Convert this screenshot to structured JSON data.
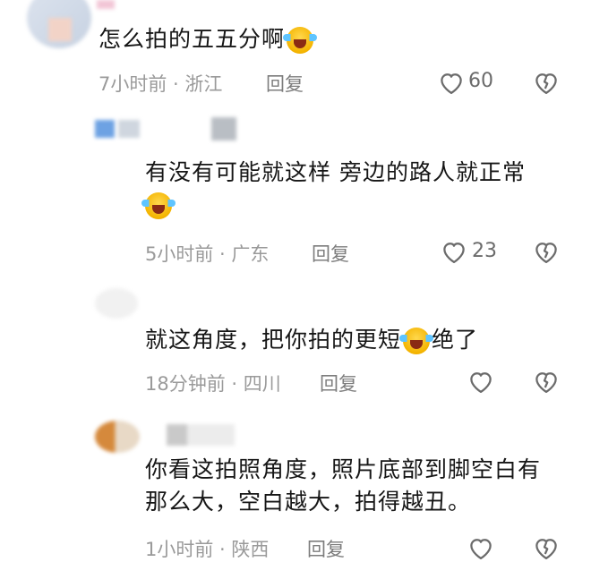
{
  "comments": [
    {
      "text_parts": [
        "怎么拍的五五分啊"
      ],
      "meta": "7小时前 · 浙江",
      "reply": "回复",
      "likes": "60"
    },
    {
      "text_parts": [
        "有没有可能就这样  旁边的路人就正常"
      ],
      "meta": "5小时前 · 广东",
      "reply": "回复",
      "likes": "23"
    },
    {
      "text_parts": [
        "就这角度，把你拍的更短",
        "绝了"
      ],
      "meta": "18分钟前 · 四川",
      "reply": "回复",
      "likes": ""
    },
    {
      "text_parts": [
        "你看这拍照角度，照片底部到脚空白有",
        "那么大，空白越大，拍得越丑。"
      ],
      "meta": "1小时前 · 陕西",
      "reply": "回复",
      "likes": ""
    }
  ],
  "icons": {
    "like": "heart-outline-icon",
    "dislike": "broken-heart-icon",
    "emoji": "laughing-crying-emoji-icon"
  },
  "colors": {
    "text": "#161616",
    "meta": "#9a9a9a",
    "icon": "#6b6b6b"
  }
}
